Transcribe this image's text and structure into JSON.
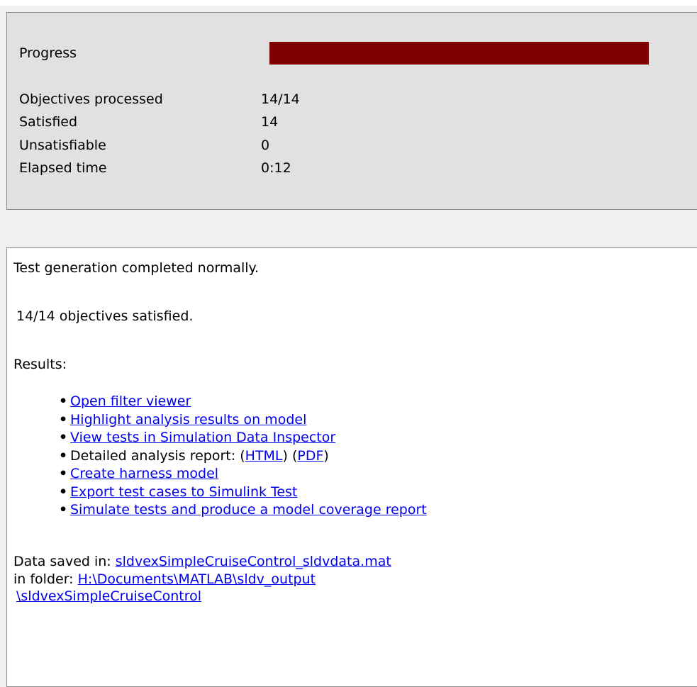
{
  "progress_panel": {
    "progress_label": "Progress",
    "progress_fraction": 1.0,
    "progress_color": "#800000",
    "stats": [
      {
        "label": "Objectives processed",
        "value": "14/14"
      },
      {
        "label": "Satisfied",
        "value": "14"
      },
      {
        "label": "Unsatisfiable",
        "value": "0"
      },
      {
        "label": "Elapsed time",
        "value": "0:12"
      }
    ]
  },
  "results_panel": {
    "status_message": "Test generation completed normally.",
    "objectives_summary": "14/14 objectives satisfied.",
    "results_heading": "Results:",
    "links": {
      "open_filter_viewer": "Open filter viewer",
      "highlight_results": "Highlight analysis results on model",
      "view_tests_sdi": "View tests in Simulation Data Inspector",
      "report_prefix": "Detailed analysis report: (",
      "report_html": "HTML",
      "report_mid": ") (",
      "report_pdf": "PDF",
      "report_suffix": ")",
      "create_harness": "Create harness model",
      "export_test_cases": "Export test cases to Simulink Test",
      "simulate_tests": "Simulate tests and produce a model coverage report"
    },
    "data_saved_label": "Data saved in: ",
    "data_file": "sldvexSimpleCruiseControl_sldvdata.mat",
    "folder_label": "in folder: ",
    "folder_path_line1": "H:\\Documents\\MATLAB\\sldv_output",
    "folder_path_line2": "\\sldvexSimpleCruiseControl"
  }
}
